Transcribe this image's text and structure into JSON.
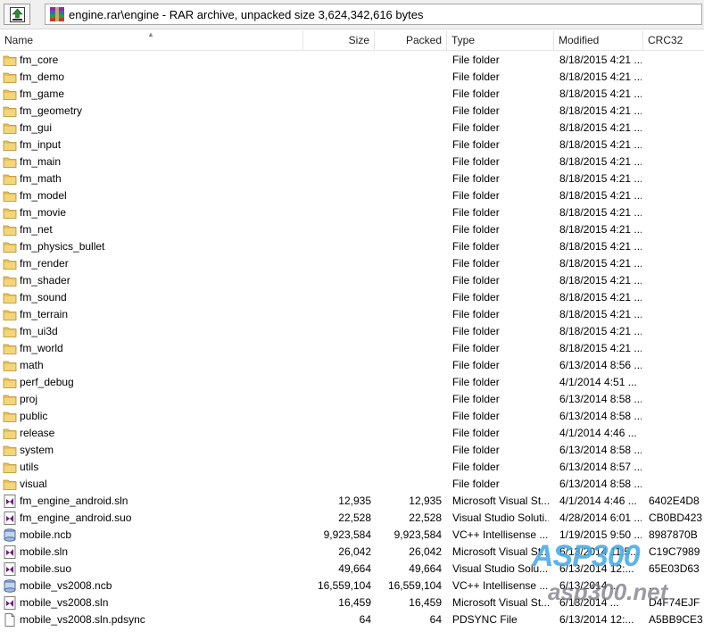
{
  "address": {
    "path": "engine.rar\\engine - RAR archive, unpacked size 3,624,342,616 bytes"
  },
  "columns": {
    "name": "Name",
    "size": "Size",
    "packed": "Packed",
    "type": "Type",
    "modified": "Modified",
    "crc": "CRC32"
  },
  "icons": {
    "up": "up-folder-icon",
    "archive": "rar-archive-icon",
    "folder": "folder-icon",
    "vs": "visual-studio-file-icon",
    "ncb": "intellisense-db-icon",
    "doc": "generic-file-icon"
  },
  "colors": {
    "folder": "#e8c05a",
    "vs": "#68217a",
    "watermark_main": "#46aae6"
  },
  "files": [
    {
      "name": "fm_core",
      "size": "",
      "packed": "",
      "type": "File folder",
      "modified": "8/18/2015 4:21 ...",
      "crc": "",
      "icon": "folder"
    },
    {
      "name": "fm_demo",
      "size": "",
      "packed": "",
      "type": "File folder",
      "modified": "8/18/2015 4:21 ...",
      "crc": "",
      "icon": "folder"
    },
    {
      "name": "fm_game",
      "size": "",
      "packed": "",
      "type": "File folder",
      "modified": "8/18/2015 4:21 ...",
      "crc": "",
      "icon": "folder"
    },
    {
      "name": "fm_geometry",
      "size": "",
      "packed": "",
      "type": "File folder",
      "modified": "8/18/2015 4:21 ...",
      "crc": "",
      "icon": "folder"
    },
    {
      "name": "fm_gui",
      "size": "",
      "packed": "",
      "type": "File folder",
      "modified": "8/18/2015 4:21 ...",
      "crc": "",
      "icon": "folder"
    },
    {
      "name": "fm_input",
      "size": "",
      "packed": "",
      "type": "File folder",
      "modified": "8/18/2015 4:21 ...",
      "crc": "",
      "icon": "folder"
    },
    {
      "name": "fm_main",
      "size": "",
      "packed": "",
      "type": "File folder",
      "modified": "8/18/2015 4:21 ...",
      "crc": "",
      "icon": "folder"
    },
    {
      "name": "fm_math",
      "size": "",
      "packed": "",
      "type": "File folder",
      "modified": "8/18/2015 4:21 ...",
      "crc": "",
      "icon": "folder"
    },
    {
      "name": "fm_model",
      "size": "",
      "packed": "",
      "type": "File folder",
      "modified": "8/18/2015 4:21 ...",
      "crc": "",
      "icon": "folder"
    },
    {
      "name": "fm_movie",
      "size": "",
      "packed": "",
      "type": "File folder",
      "modified": "8/18/2015 4:21 ...",
      "crc": "",
      "icon": "folder"
    },
    {
      "name": "fm_net",
      "size": "",
      "packed": "",
      "type": "File folder",
      "modified": "8/18/2015 4:21 ...",
      "crc": "",
      "icon": "folder"
    },
    {
      "name": "fm_physics_bullet",
      "size": "",
      "packed": "",
      "type": "File folder",
      "modified": "8/18/2015 4:21 ...",
      "crc": "",
      "icon": "folder"
    },
    {
      "name": "fm_render",
      "size": "",
      "packed": "",
      "type": "File folder",
      "modified": "8/18/2015 4:21 ...",
      "crc": "",
      "icon": "folder"
    },
    {
      "name": "fm_shader",
      "size": "",
      "packed": "",
      "type": "File folder",
      "modified": "8/18/2015 4:21 ...",
      "crc": "",
      "icon": "folder"
    },
    {
      "name": "fm_sound",
      "size": "",
      "packed": "",
      "type": "File folder",
      "modified": "8/18/2015 4:21 ...",
      "crc": "",
      "icon": "folder"
    },
    {
      "name": "fm_terrain",
      "size": "",
      "packed": "",
      "type": "File folder",
      "modified": "8/18/2015 4:21 ...",
      "crc": "",
      "icon": "folder"
    },
    {
      "name": "fm_ui3d",
      "size": "",
      "packed": "",
      "type": "File folder",
      "modified": "8/18/2015 4:21 ...",
      "crc": "",
      "icon": "folder"
    },
    {
      "name": "fm_world",
      "size": "",
      "packed": "",
      "type": "File folder",
      "modified": "8/18/2015 4:21 ...",
      "crc": "",
      "icon": "folder"
    },
    {
      "name": "math",
      "size": "",
      "packed": "",
      "type": "File folder",
      "modified": "6/13/2014 8:56 ...",
      "crc": "",
      "icon": "folder"
    },
    {
      "name": "perf_debug",
      "size": "",
      "packed": "",
      "type": "File folder",
      "modified": "4/1/2014 4:51 ...",
      "crc": "",
      "icon": "folder"
    },
    {
      "name": "proj",
      "size": "",
      "packed": "",
      "type": "File folder",
      "modified": "6/13/2014 8:58 ...",
      "crc": "",
      "icon": "folder"
    },
    {
      "name": "public",
      "size": "",
      "packed": "",
      "type": "File folder",
      "modified": "6/13/2014 8:58 ...",
      "crc": "",
      "icon": "folder"
    },
    {
      "name": "release",
      "size": "",
      "packed": "",
      "type": "File folder",
      "modified": "4/1/2014 4:46 ...",
      "crc": "",
      "icon": "folder"
    },
    {
      "name": "system",
      "size": "",
      "packed": "",
      "type": "File folder",
      "modified": "6/13/2014 8:58 ...",
      "crc": "",
      "icon": "folder"
    },
    {
      "name": "utils",
      "size": "",
      "packed": "",
      "type": "File folder",
      "modified": "6/13/2014 8:57 ...",
      "crc": "",
      "icon": "folder"
    },
    {
      "name": "visual",
      "size": "",
      "packed": "",
      "type": "File folder",
      "modified": "6/13/2014 8:58 ...",
      "crc": "",
      "icon": "folder"
    },
    {
      "name": "fm_engine_android.sln",
      "size": "12,935",
      "packed": "12,935",
      "type": "Microsoft Visual St...",
      "modified": "4/1/2014 4:46 ...",
      "crc": "6402E4D8",
      "icon": "vs"
    },
    {
      "name": "fm_engine_android.suo",
      "size": "22,528",
      "packed": "22,528",
      "type": "Visual Studio Soluti...",
      "modified": "4/28/2014 6:01 ...",
      "crc": "CB0BD423",
      "icon": "vs"
    },
    {
      "name": "mobile.ncb",
      "size": "9,923,584",
      "packed": "9,923,584",
      "type": "VC++ Intellisense ...",
      "modified": "1/19/2015 9:50 ...",
      "crc": "8987870B",
      "icon": "ncb"
    },
    {
      "name": "mobile.sln",
      "size": "26,042",
      "packed": "26,042",
      "type": "Microsoft Visual St...",
      "modified": "6/13/2014 11:5...",
      "crc": "C19C7989",
      "icon": "vs"
    },
    {
      "name": "mobile.suo",
      "size": "49,664",
      "packed": "49,664",
      "type": "Visual Studio Solu...",
      "modified": "6/13/2014 12:...",
      "crc": "65E03D63",
      "icon": "vs"
    },
    {
      "name": "mobile_vs2008.ncb",
      "size": "16,559,104",
      "packed": "16,559,104",
      "type": "VC++ Intellisense ...",
      "modified": "6/13/2014 ...",
      "crc": "...",
      "icon": "ncb"
    },
    {
      "name": "mobile_vs2008.sln",
      "size": "16,459",
      "packed": "16,459",
      "type": "Microsoft Visual St...",
      "modified": "6/13/2014 ...",
      "crc": "D4F74EJF",
      "icon": "vs"
    },
    {
      "name": "mobile_vs2008.sln.pdsync",
      "size": "64",
      "packed": "64",
      "type": "PDSYNC File",
      "modified": "6/13/2014 12:...",
      "crc": "A5BB9CE3",
      "icon": "doc"
    }
  ],
  "watermark": {
    "brand": "ASP300",
    "domain": "asp300.net"
  }
}
